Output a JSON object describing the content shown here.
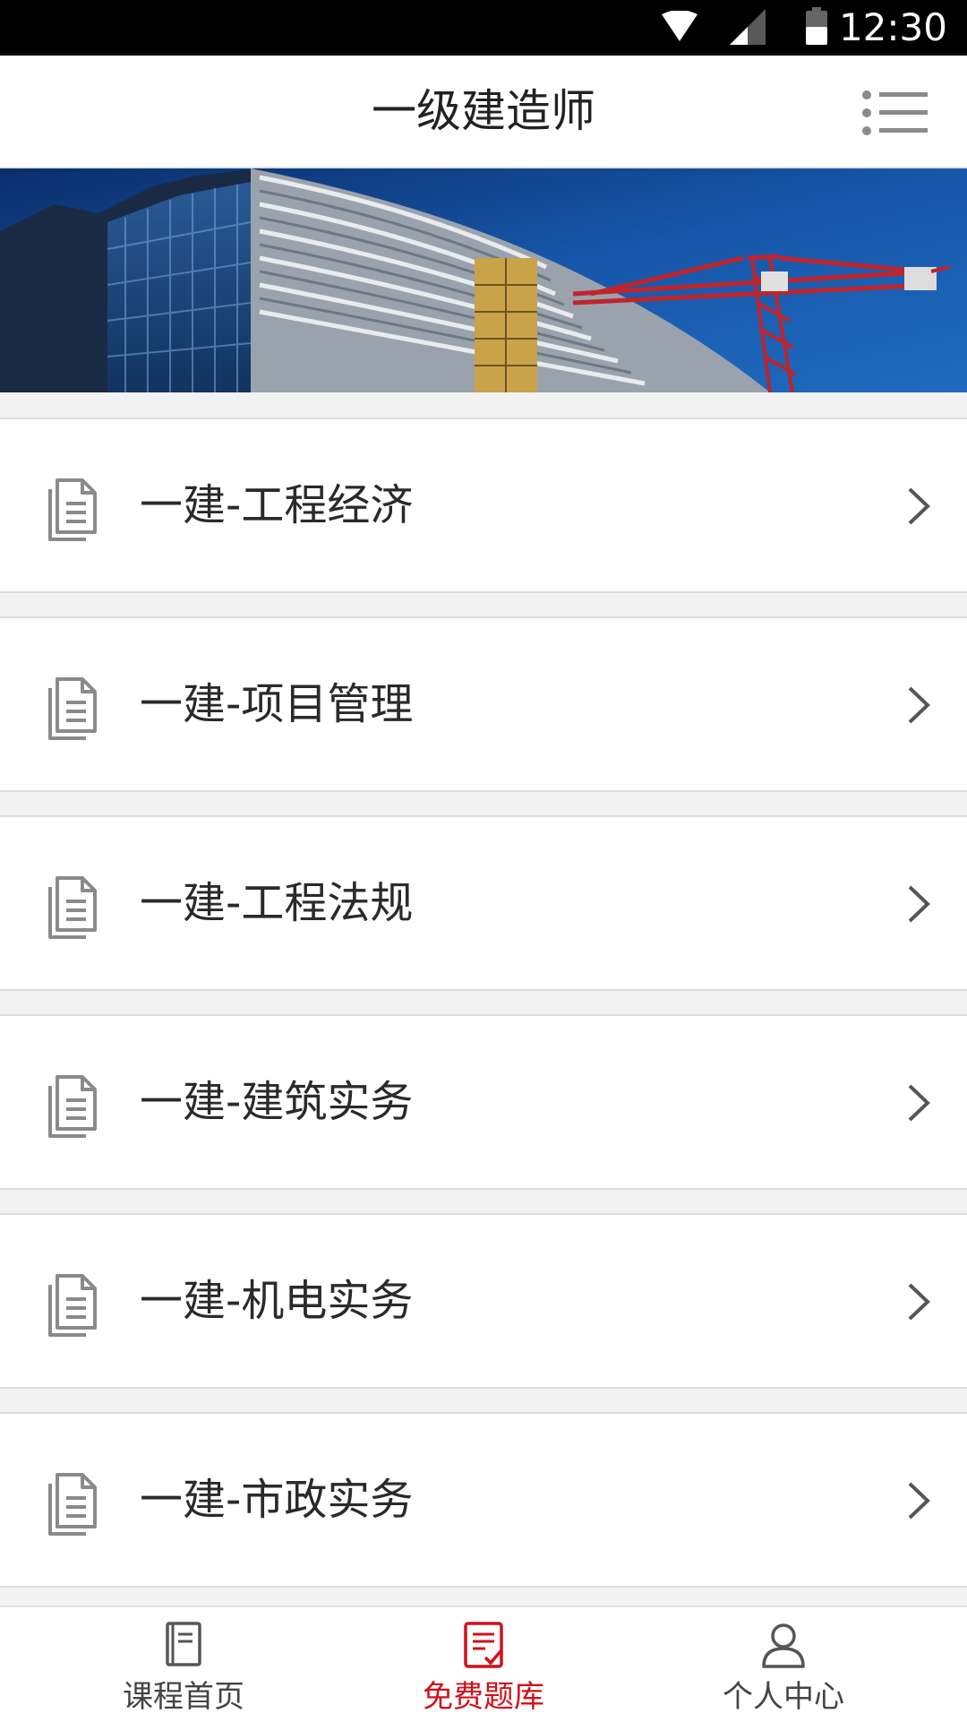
{
  "status_bar": {
    "time": "12:30",
    "icons": [
      "wifi-icon",
      "signal-icon",
      "battery-icon"
    ]
  },
  "header": {
    "title": "一级建造师",
    "menu_icon": "list-menu-icon"
  },
  "banner": {
    "image": "construction-building-with-crane"
  },
  "courses": [
    {
      "label": "一建-工程经济",
      "icon": "document-icon"
    },
    {
      "label": "一建-项目管理",
      "icon": "document-icon"
    },
    {
      "label": "一建-工程法规",
      "icon": "document-icon"
    },
    {
      "label": "一建-建筑实务",
      "icon": "document-icon"
    },
    {
      "label": "一建-机电实务",
      "icon": "document-icon"
    },
    {
      "label": "一建-市政实务",
      "icon": "document-icon"
    }
  ],
  "tab_bar": {
    "tabs": [
      {
        "label": "课程首页",
        "icon": "book-icon",
        "active": false
      },
      {
        "label": "免费题库",
        "icon": "checklist-icon",
        "active": true
      },
      {
        "label": "个人中心",
        "icon": "user-icon",
        "active": false
      }
    ]
  },
  "colors": {
    "accent": "#d0101b",
    "icon_gray": "#8a8a8a",
    "background": "#f2f2f2"
  }
}
